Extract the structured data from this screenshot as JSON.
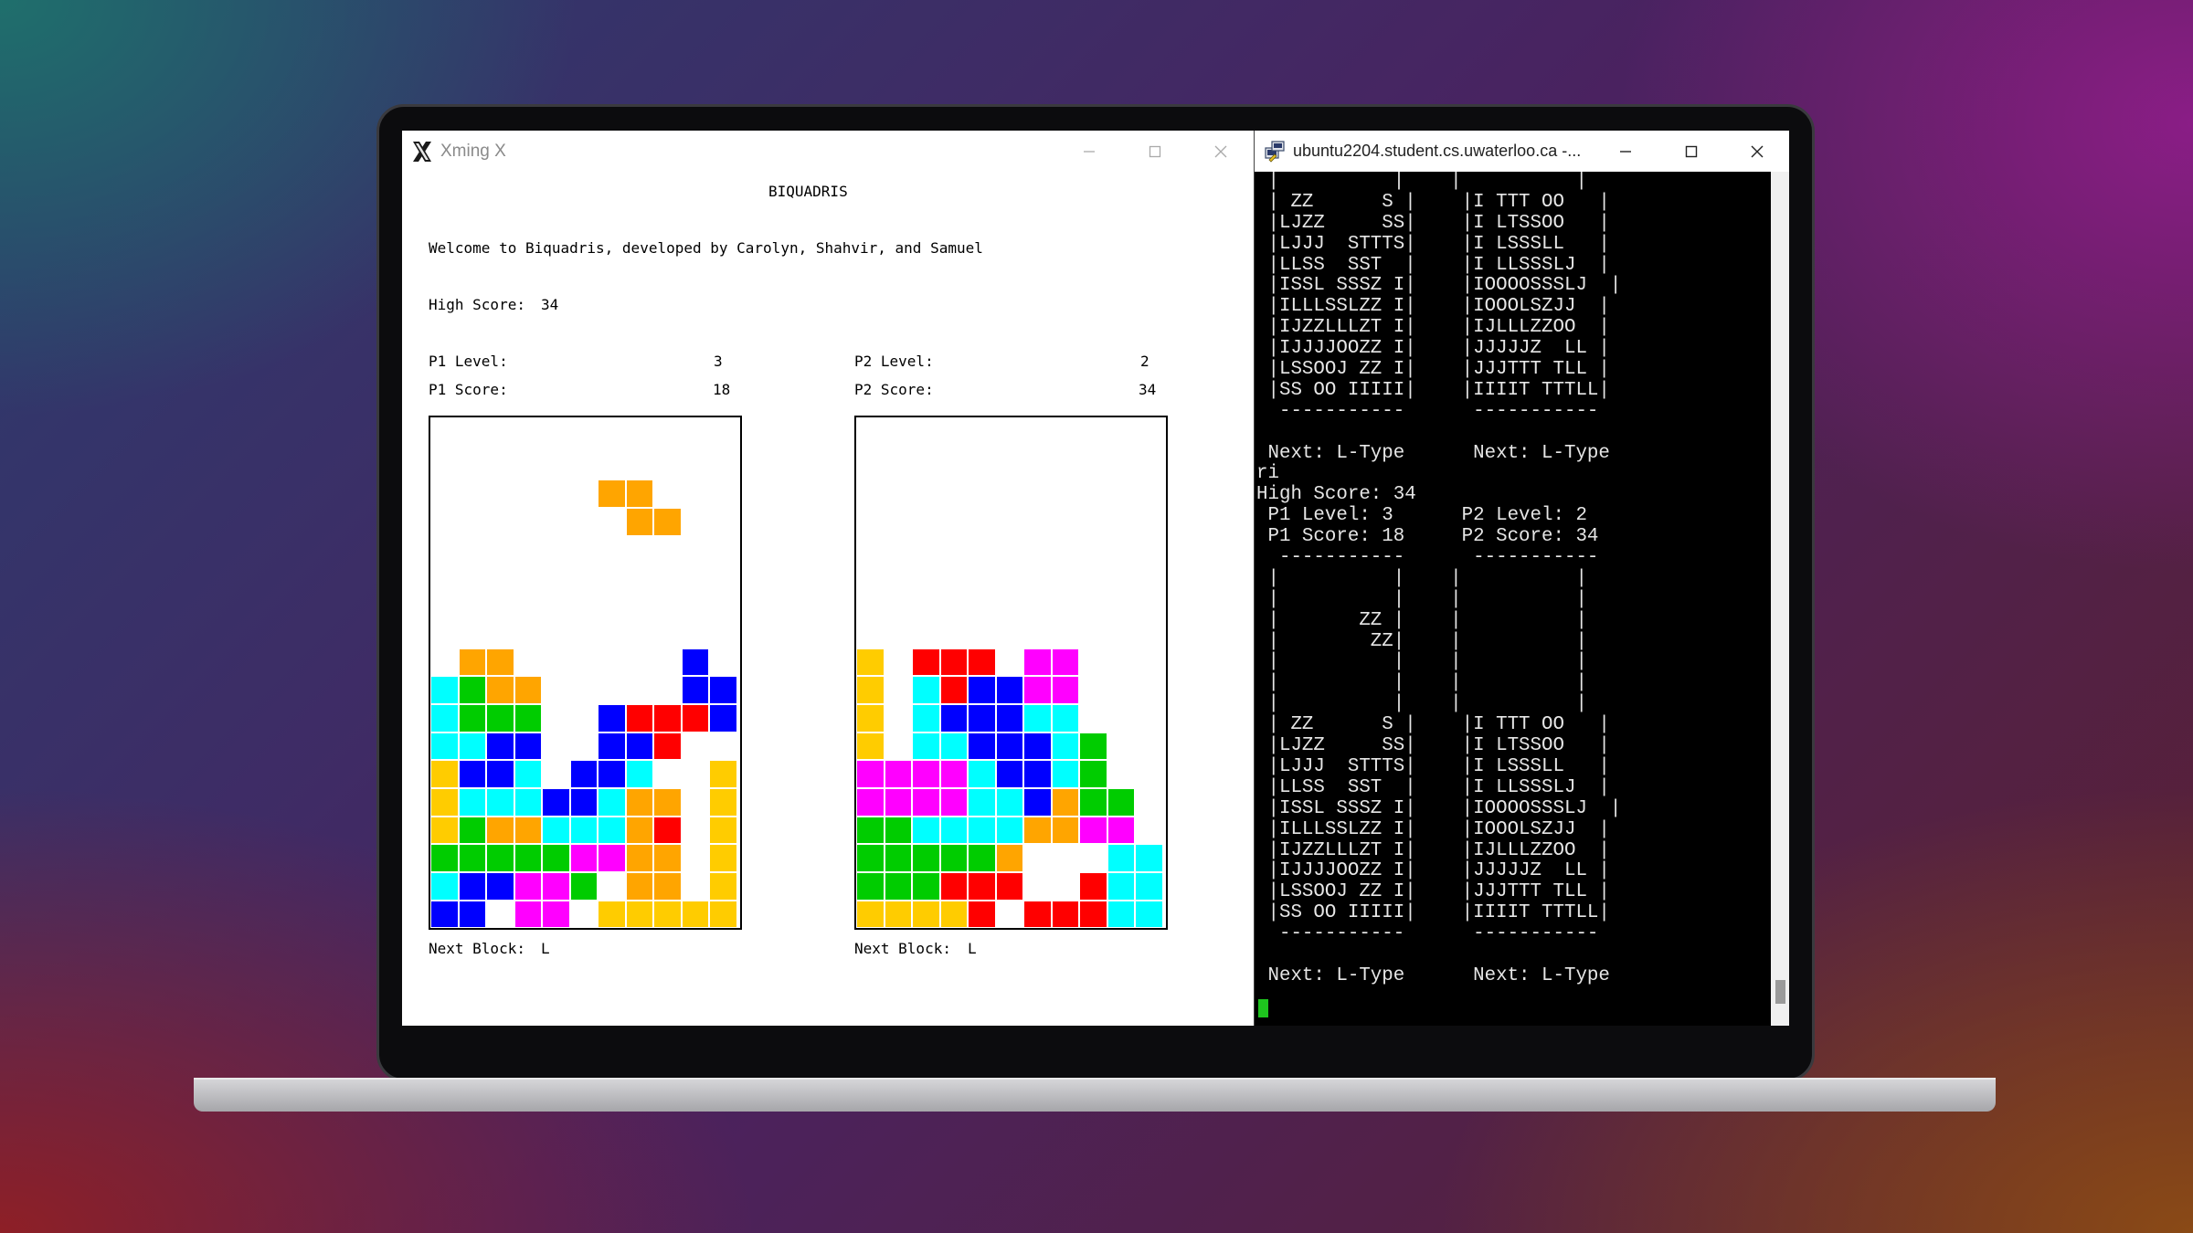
{
  "xming": {
    "title": "Xming X",
    "game_title": "BIQUADRIS",
    "welcome": "Welcome to Biquadris, developed by Carolyn, Shahvir, and Samuel",
    "high_score_label": "High Score:",
    "high_score": "34",
    "p1": {
      "level_label": "P1 Level:",
      "level": "3",
      "score_label": "P1 Score:",
      "score": "18",
      "next_label": "Next Block:",
      "next": "L"
    },
    "p2": {
      "level_label": "P2 Level:",
      "level": "2",
      "score_label": "P2 Score:",
      "score": "34",
      "next_label": "Next Block:",
      "next": "L"
    },
    "colors": {
      "Y": "#ffcc00",
      "O": "#ffa500",
      "C": "#00ffff",
      "G": "#00cc00",
      "B": "#0000ff",
      "R": "#ff0000",
      "M": "#ff00ff"
    },
    "board_p1": [
      "...........",
      "...........",
      "......OO...",
      ".......OO..",
      "...........",
      "...........",
      "...........",
      "...........",
      ".OO......B.",
      "CGOO.....BB",
      "CGGG..BRRRB",
      "CCBB..BBR..",
      "YBBC.BBC..Y",
      "YCCCBBCOO.Y",
      "YGOOCCCOR.Y",
      "GGGGGMMOO.Y",
      "CBBMMG.OO.Y",
      "BB.MM.YYYYY"
    ],
    "board_p2": [
      "...........",
      "...........",
      "...........",
      "...........",
      "...........",
      "...........",
      "...........",
      "...........",
      "Y.RRR.MM...",
      "Y.CRBBMM...",
      "Y.CBBBCC...",
      "Y.CCBBBCG..",
      "MMMMCBBCG..",
      "MMMMCCBOGG.",
      "GGCCCCOOMM.",
      "GGGGGO...CC",
      "GGGRRR..RCC",
      "YYYYR.RRRCC"
    ]
  },
  "terminal": {
    "title": "ubuntu2204.student.cs.uwaterloo.ca -...",
    "lines": [
      " |          |    |          |",
      " | ZZ      S |    |I TTT OO   |",
      " |LJZZ     SS|    |I LTSSOO   |",
      " |LJJJ  STTTS|    |I LSSSLL   |",
      " |LLSS  SST  |    |I LLSSSLJ  |",
      " |ISSL SSSZ I|    |IOOOOSSSLJ  |",
      " |ILLLSSLZZ I|    |IOOOLSZJJ  |",
      " |IJZZLLLZT I|    |IJLLLZZOO  |",
      " |IJJJJOOZZ I|    |JJJJJZ  LL |",
      " |LSSOOJ ZZ I|    |JJJTTT TLL |",
      " |SS OO IIIII|    |IIIIT TTTLL|",
      "  -----------      -----------",
      "",
      " Next: L-Type      Next: L-Type",
      "ri",
      "High Score: 34",
      " P1 Level: 3      P2 Level: 2",
      " P1 Score: 18     P2 Score: 34",
      "  -----------      -----------",
      " |          |    |          |",
      " |          |    |          |",
      " |       ZZ |    |          |",
      " |        ZZ|    |          |",
      " |          |    |          |",
      " |          |    |          |",
      " |          |    |          |",
      " | ZZ      S |    |I TTT OO   |",
      " |LJZZ     SS|    |I LTSSOO   |",
      " |LJJJ  STTTS|    |I LSSSLL   |",
      " |LLSS  SST  |    |I LLSSSLJ  |",
      " |ISSL SSSZ I|    |IOOOOSSSLJ  |",
      " |ILLLSSLZZ I|    |IOOOLSZJJ  |",
      " |IJZZLLLZT I|    |IJLLLZZOO  |",
      " |IJJJJOOZZ I|    |JJJJJZ  LL |",
      " |LSSOOJ ZZ I|    |JJJTTT TLL |",
      " |SS OO IIIII|    |IIIIT TTTLL|",
      "  -----------      -----------",
      "",
      " Next: L-Type      Next: L-Type"
    ]
  }
}
